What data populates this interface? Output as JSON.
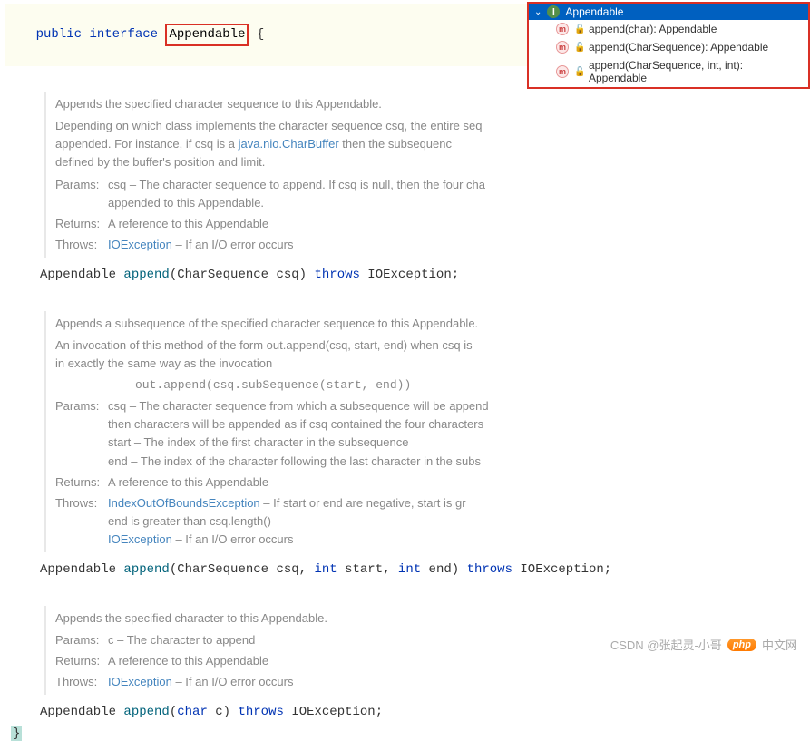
{
  "header": {
    "kw_public": "public",
    "kw_interface": "interface",
    "class_name": "Appendable",
    "brace": "{"
  },
  "structure": {
    "title": "Appendable",
    "items": [
      "append(char): Appendable",
      "append(CharSequence): Appendable",
      "append(CharSequence, int, int): Appendable"
    ]
  },
  "doc1": {
    "desc1": "Appends the specified character sequence to this Appendable.",
    "desc2a": "Depending on which class implements the character sequence csq, the entire seq",
    "desc2b": "appended. For instance, if csq is a ",
    "type_link": "java.nio.CharBuffer",
    "desc2c": " then the subsequenc",
    "desc2d": "defined by the buffer's position and limit.",
    "params_label": "Params:",
    "params_text1": "csq – The character sequence to append. If csq is null, then the four cha",
    "params_text2": "appended to this Appendable.",
    "returns_label": "Returns:",
    "returns_text": "A reference to this Appendable",
    "throws_label": "Throws:",
    "throws_link": "IOException",
    "throws_text": " – If an I/O error occurs"
  },
  "sig1": {
    "ret": "Appendable ",
    "method": "append",
    "p1": "(CharSequence csq) ",
    "throws": "throws",
    "ex": " IOException;"
  },
  "doc2": {
    "desc1": "Appends a subsequence of the specified character sequence to this Appendable.",
    "desc2a": "An invocation of this method of the form out.append(csq, start, end) when csq is",
    "desc2b": "in exactly the same way as the invocation",
    "code_line": "out.append(csq.subSequence(start, end))",
    "params_label": "Params:",
    "params_text1": "csq – The character sequence from which a subsequence will be append",
    "params_text2": "then characters will be appended as if csq contained the four characters",
    "params_text3": "start – The index of the first character in the subsequence",
    "params_text4": "end – The index of the character following the last character in the subs",
    "returns_label": "Returns:",
    "returns_text": "A reference to this Appendable",
    "throws_label": "Throws:",
    "throws_link1": "IndexOutOfBoundsException",
    "throws_text1": " – If start or end are negative, start is gr",
    "throws_text1b": "end is greater than csq.length()",
    "throws_link2": "IOException",
    "throws_text2": " – If an I/O error occurs"
  },
  "sig2": {
    "ret": "Appendable ",
    "method": "append",
    "p1": "(CharSequence csq, ",
    "int1": "int",
    "p2": " start, ",
    "int2": "int",
    "p3": " end) ",
    "throws": "throws",
    "ex": " IOException;"
  },
  "doc3": {
    "desc1": "Appends the specified character to this Appendable.",
    "params_label": "Params:",
    "params_text": "c – The character to append",
    "returns_label": "Returns:",
    "returns_text": "A reference to this Appendable",
    "throws_label": "Throws:",
    "throws_link": "IOException",
    "throws_text": " – If an I/O error occurs"
  },
  "sig3": {
    "ret": "Appendable ",
    "method": "append",
    "p1": "(",
    "char": "char",
    "p2": " c) ",
    "throws": "throws",
    "ex": " IOException;"
  },
  "closing": "}",
  "watermark": {
    "csdn": "CSDN @张起灵-小哥",
    "php_badge": "php",
    "cn": "中文网"
  }
}
